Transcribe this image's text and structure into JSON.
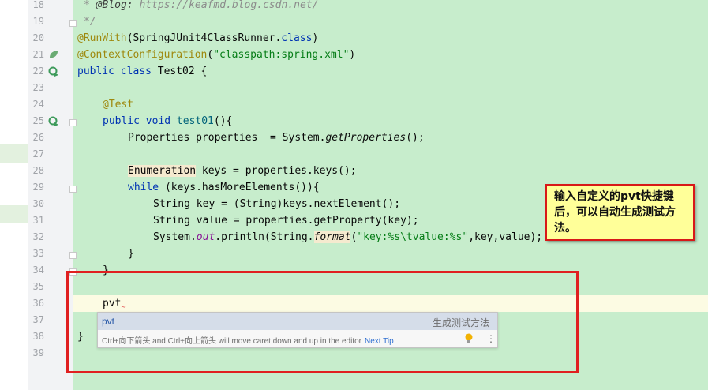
{
  "editor": {
    "lines": [
      {
        "num": "18"
      },
      {
        "num": "19"
      },
      {
        "num": "20"
      },
      {
        "num": "21"
      },
      {
        "num": "22"
      },
      {
        "num": "23"
      },
      {
        "num": "24"
      },
      {
        "num": "25"
      },
      {
        "num": "26"
      },
      {
        "num": "27"
      },
      {
        "num": "28"
      },
      {
        "num": "29"
      },
      {
        "num": "30"
      },
      {
        "num": "31"
      },
      {
        "num": "32"
      },
      {
        "num": "33"
      },
      {
        "num": "34"
      },
      {
        "num": "35"
      },
      {
        "num": "36"
      },
      {
        "num": "37"
      },
      {
        "num": "38"
      },
      {
        "num": "39"
      }
    ],
    "code": {
      "l18_tag": "@Blog:",
      "l18_url": " https://keafmd.blog.csdn.net/",
      "l19": "*/",
      "l20_anno": "@RunWith",
      "l20_arg": "SpringJUnit4ClassRunner",
      "l20_cls": "class",
      "l21_anno": "@ContextConfiguration",
      "l21_str": "\"classpath:spring.xml\"",
      "l22_kw": "public class",
      "l22_rest": " Test02 {",
      "l24_anno": "@Test",
      "l25_kw": "public void",
      "l25_name": "test01",
      "l25_rest": "(){",
      "l26_a": "Properties properties  = System.",
      "l26_m": "getProperties",
      "l26_b": "();",
      "l28_type": "Enumeration",
      "l28_rest": " keys = properties.keys();",
      "l29_kw": "while",
      "l29_rest": " (keys.hasMoreElements()){",
      "l30": "String key = (String)keys.nextElement();",
      "l31": "String value = properties.getProperty(key);",
      "l32_a": "System.",
      "l32_out": "out",
      "l32_b": ".println(String.",
      "l32_fmt": "format",
      "l32_c": "(",
      "l32_str": "\"key:%s\\tvalue:%s\"",
      "l32_d": ",key,value);",
      "l33": "}",
      "l34": "}",
      "l36": "pvt",
      "l38": "}"
    }
  },
  "popup": {
    "abbreviation": "pvt",
    "description": "生成测试方法",
    "hint": "Ctrl+向下箭头 and Ctrl+向上箭头 will move caret down and up in the editor",
    "next_tip": "Next Tip"
  },
  "annotation": {
    "text": "输入自定义的pvt快捷键后，可以自动生成测试方法。"
  },
  "colors": {
    "editor_bg": "#c7edcc",
    "annotation_bg": "#ffff99",
    "highlight_border": "#e02020"
  }
}
